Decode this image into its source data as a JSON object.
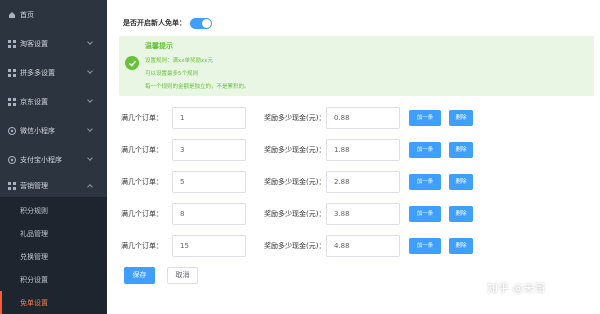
{
  "sidebar": {
    "items": [
      {
        "label": "首页",
        "icon": "home-icon",
        "expandable": false
      },
      {
        "label": "淘客设置",
        "icon": "grid-icon",
        "expandable": true
      },
      {
        "label": "拼多多设置",
        "icon": "grid-icon",
        "expandable": true
      },
      {
        "label": "京东设置",
        "icon": "grid-icon",
        "expandable": true
      },
      {
        "label": "微信小程序",
        "icon": "wechat-icon",
        "expandable": true
      },
      {
        "label": "支付宝小程序",
        "icon": "alipay-icon",
        "expandable": true
      },
      {
        "label": "营销管理",
        "icon": "grid-icon",
        "expandable": true,
        "expanded": true
      }
    ],
    "subitems": [
      {
        "label": "积分规则"
      },
      {
        "label": "礼品管理"
      },
      {
        "label": "兑换管理"
      },
      {
        "label": "积分设置"
      },
      {
        "label": "免单设置",
        "active": true
      }
    ]
  },
  "main": {
    "toggle": {
      "label": "是否开启新人免单：",
      "on": true
    },
    "tip": {
      "title": "温馨提示",
      "lines": [
        "设置规则：满xx单奖励xx元",
        "可以设置最多5个规则",
        "每一个规则的金额是独立的，不是累积的。"
      ]
    },
    "rule_label_orders": "满几个订单：",
    "rule_label_reward": "奖励多少现金(元)：",
    "add_label": "加一条",
    "delete_label": "删除",
    "rules": [
      {
        "orders": "1",
        "reward": "0.88"
      },
      {
        "orders": "3",
        "reward": "1.88"
      },
      {
        "orders": "5",
        "reward": "2.88"
      },
      {
        "orders": "8",
        "reward": "3.88"
      },
      {
        "orders": "15",
        "reward": "4.88"
      }
    ],
    "save_label": "保存",
    "cancel_label": "取消"
  },
  "watermark": "知乎 @米哥",
  "colors": {
    "sidebar_bg": "#2c3440",
    "primary": "#409eff",
    "success": "#67c23a",
    "active_menu": "#ff5a36"
  }
}
